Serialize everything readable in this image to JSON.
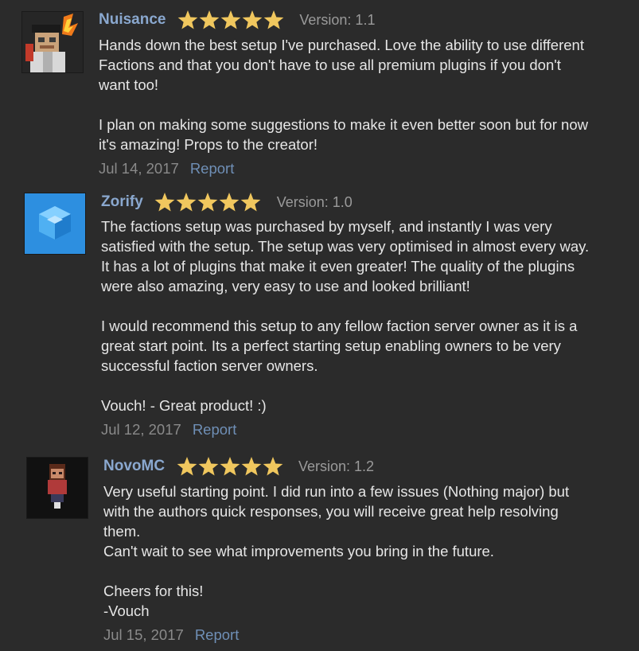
{
  "reviews": [
    {
      "username": "Nuisance",
      "rating": 5,
      "version": "Version: 1.1",
      "lines": [
        "Hands down the best setup I've purchased. Love the ability to use different",
        "Factions and that you don't have to use all premium plugins if you don't",
        "want too!",
        "",
        "I plan on making some suggestions to make it even better soon but for now",
        "it's amazing! Props to the creator!"
      ],
      "date": "Jul 14, 2017",
      "report_label": "Report"
    },
    {
      "username": "Zorify",
      "rating": 5,
      "version": "Version: 1.0",
      "lines": [
        "The factions setup was purchased by myself, and instantly I was very",
        "satisfied with the setup. The setup was very optimised in almost every way.",
        "It has a lot of plugins that make it even greater! The quality of the plugins",
        "were also amazing, very easy to use and looked brilliant!",
        "",
        "I would recommend this setup to any fellow faction server owner as it is a",
        "great start point. Its a perfect starting setup enabling owners to be very",
        "successful faction server owners.",
        "",
        "Vouch! - Great product! :)"
      ],
      "date": "Jul 12, 2017",
      "report_label": "Report"
    },
    {
      "username": "NovoMC",
      "rating": 5,
      "version": "Version: 1.2",
      "lines": [
        "Very useful starting point. I did run into a few issues (Nothing major) but",
        "with the authors quick responses, you will receive great help resolving",
        "them.",
        "Can't wait to see what improvements you bring in the future.",
        "",
        "Cheers for this!",
        "-Vouch"
      ],
      "date": "Jul 15, 2017",
      "report_label": "Report"
    }
  ],
  "colors": {
    "background": "#2b2b2b",
    "username": "#8aa8cf",
    "star": "#f0c75e",
    "text": "#e6e6e6",
    "muted": "#8a8a8a",
    "link": "#6f8fb6"
  },
  "icons": {
    "star": "star-icon"
  }
}
